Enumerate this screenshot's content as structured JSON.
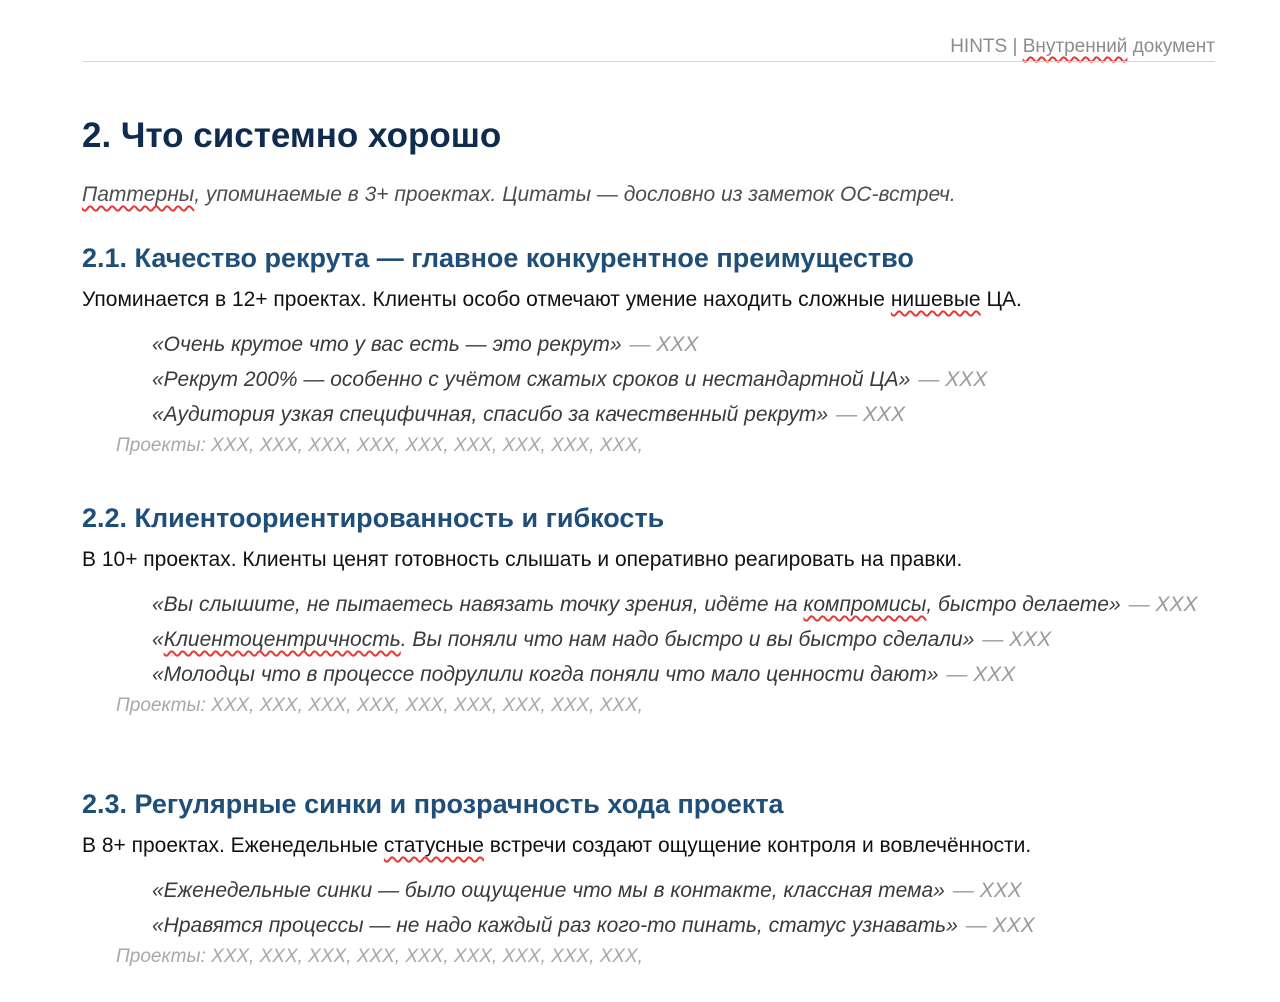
{
  "header": {
    "brand": "HINTS",
    "separator": " | ",
    "doc_type_word1": "Внутренний",
    "doc_type_word2": " документ"
  },
  "page_title": "2. Что системно хорошо",
  "subtitle": {
    "word1": "Паттерны",
    "rest": ", упоминаемые в 3+ проектах. Цитаты — дословно из заметок ОС-встреч."
  },
  "sections": [
    {
      "heading": "2.1. Качество рекрута — главное конкурентное преимущество",
      "lead_before": "Упоминается в 12+ проектах. Клиенты особо отмечают умение находить сложные ",
      "lead_marked": "нишевые",
      "lead_after": " ЦА.",
      "quotes": [
        {
          "text": "«Очень крутое что у вас есть — это рекрут»",
          "author": "— XXX"
        },
        {
          "text": "«Рекрут 200% — особенно с учётом сжатых сроков и нестандартной ЦА»",
          "author": "— XXX"
        },
        {
          "text": "«Аудитория узкая специфичная, спасибо за качественный рекрут»",
          "author": "— XXX"
        }
      ],
      "projects": "Проекты: XXX, XXX, XXX, XXX, XXX, XXX, XXX, XXX, XXX,"
    },
    {
      "heading": "2.2. Клиентоориентированность и гибкость",
      "lead": "В 10+ проектах. Клиенты ценят готовность слышать и оперативно реагировать на правки.",
      "quotes": [
        {
          "before": "«Вы слышите, не пытаетесь навязать точку зрения, идёте на ",
          "marked": "компромисы",
          "after": ", быстро делаете»",
          "author": "— XXX"
        },
        {
          "before": "«",
          "marked": "Клиентоцентричность",
          "after": ". Вы поняли что нам надо быстро и вы быстро сделали»",
          "author": "— XXX"
        },
        {
          "text": "«Молодцы что в процессе подрулили когда поняли что мало ценности дают»",
          "author": "— XXX"
        }
      ],
      "projects": "Проекты: XXX, XXX, XXX, XXX, XXX, XXX, XXX, XXX, XXX,"
    },
    {
      "heading": "2.3. Регулярные синки и прозрачность хода проекта",
      "lead_before": "В 8+ проектах. Еженедельные ",
      "lead_marked": "статусные",
      "lead_after": " встречи создают ощущение контроля и вовлечённости.",
      "quotes": [
        {
          "text": "«Еженедельные синки — было ощущение что мы в контакте, классная тема»",
          "author": "— XXX"
        },
        {
          "text": "«Нравятся процессы — не надо каждый раз кого-то пинать, статус узнавать»",
          "author": "— XXX"
        }
      ],
      "projects": "Проекты: XXX, XXX, XXX, XXX, XXX, XXX, XXX, XXX, XXX,"
    }
  ]
}
